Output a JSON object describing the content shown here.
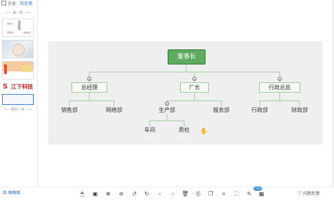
{
  "sidebar": {
    "select_all": "全选",
    "batch": "批处理",
    "section1": "第一张",
    "logo_text": "江下科技",
    "section_last": "最后一张"
  },
  "orgchart": {
    "root": "董事长",
    "branches": [
      {
        "label": "总经理",
        "children": [
          "销售部",
          "网络部"
        ]
      },
      {
        "label": "厂长",
        "children": [
          "生产部",
          "服务部"
        ]
      },
      {
        "label": "行政总监",
        "children": [
          "行政部",
          "财政部"
        ]
      }
    ],
    "sub": {
      "parent": "生产部",
      "children": [
        "车间",
        "质检"
      ]
    }
  },
  "toolbar": {
    "thumbnails_label": "缩略图",
    "new_badge": "new",
    "help_label": "问题反馈",
    "icons": [
      "mouse-icon",
      "fit-page-icon",
      "zoom-in-icon",
      "zoom-out-icon",
      "rotate-left-icon",
      "rotate-right-icon",
      "previous-icon",
      "next-icon",
      "delete-icon",
      "print-icon",
      "copy-icon",
      "crop-icon",
      "fullscreen-icon",
      "edit-icon",
      "image-edit-icon"
    ]
  },
  "colors": {
    "accent": "#5cab5f",
    "link": "#3a7bd5",
    "canvas_bg": "#efefef"
  }
}
